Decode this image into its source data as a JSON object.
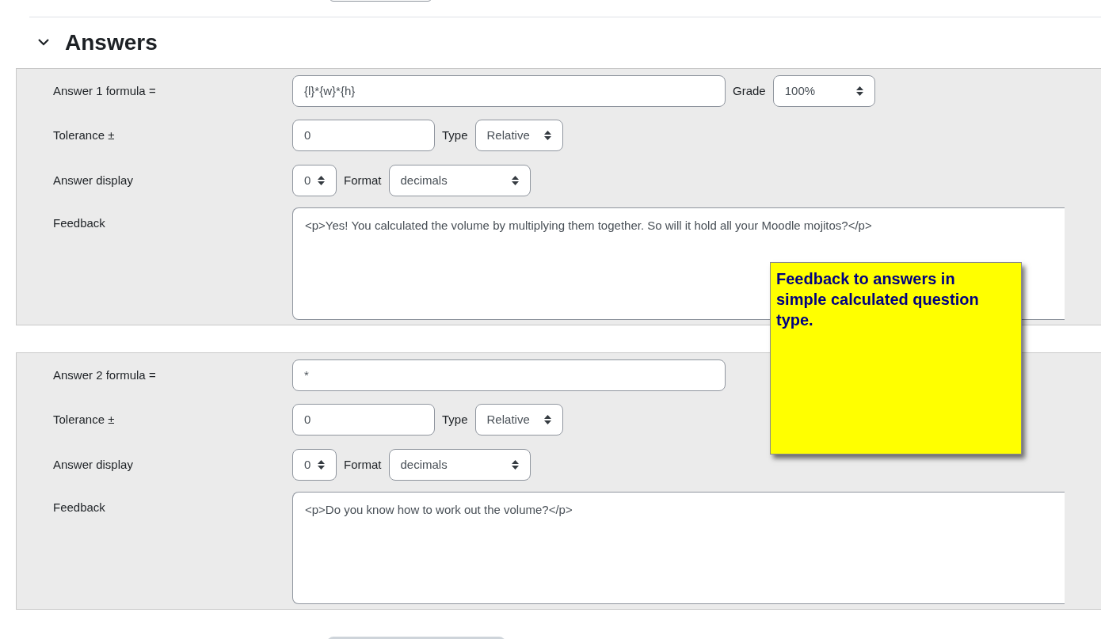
{
  "section": {
    "title": "Answers",
    "expanded": true
  },
  "answers": [
    {
      "formula_label": "Answer 1 formula =",
      "formula": "{l}*{w}*{h}",
      "grade_label": "Grade",
      "grade": "100%",
      "tolerance_label": "Tolerance ±",
      "tolerance": "0",
      "type_label": "Type",
      "type": "Relative",
      "display_label": "Answer display",
      "display": "0",
      "format_label": "Format",
      "format": "decimals",
      "feedback_label": "Feedback",
      "feedback": "<p>Yes! You calculated the volume by multiplying them together. So will it hold all your Moodle mojitos?</p>"
    },
    {
      "formula_label": "Answer 2 formula =",
      "formula": "*",
      "tolerance_label": "Tolerance ±",
      "tolerance": "0",
      "type_label": "Type",
      "type": "Relative",
      "display_label": "Answer display",
      "display": "0",
      "format_label": "Format",
      "format": "decimals",
      "feedback_label": "Feedback",
      "feedback": "<p>Do you know how to work out the volume?</p>"
    }
  ],
  "note": {
    "text": "Feedback to answers in simple calculated question type."
  }
}
